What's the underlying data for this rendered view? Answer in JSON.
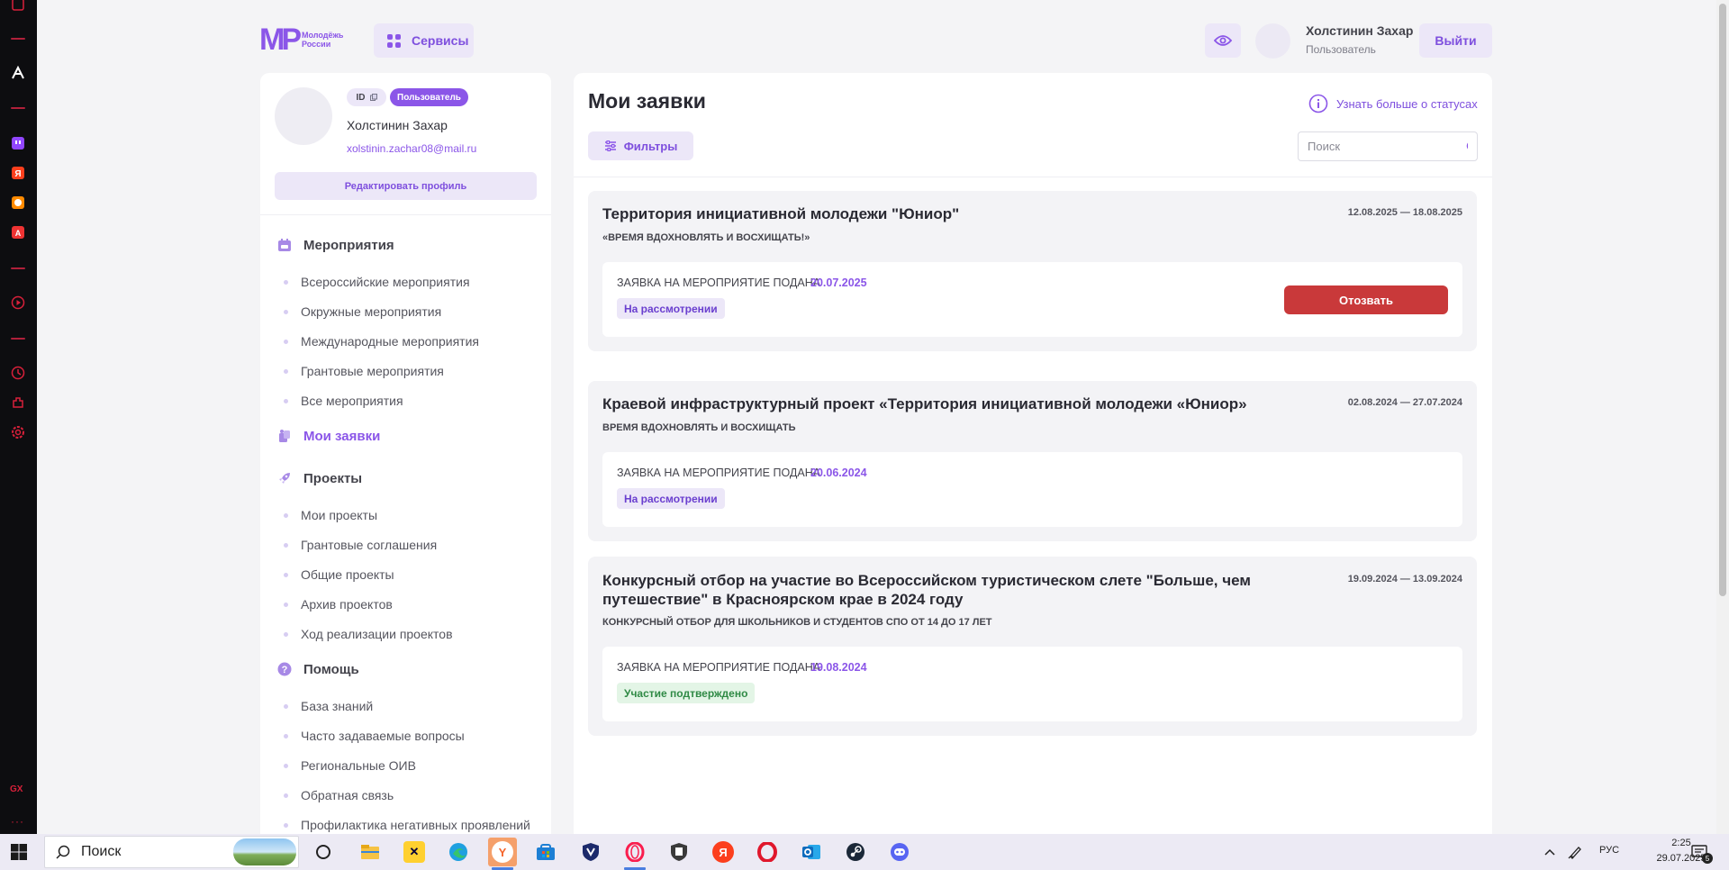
{
  "header": {
    "logo_mark": "МР",
    "logo_line1": "Молодёжь",
    "logo_line2": "России",
    "services_label": "Сервисы",
    "user_name": "Холстинин Захар",
    "user_role": "Пользователь",
    "logout_label": "Выйти"
  },
  "profile": {
    "id_label": "ID",
    "role_badge": "Пользователь",
    "name": "Холстинин Захар",
    "email": "xolstinin.zachar08@mail.ru",
    "edit_label": "Редактировать профиль"
  },
  "nav": {
    "events": {
      "title": "Мероприятия",
      "items": [
        "Всероссийские мероприятия",
        "Окружные мероприятия",
        "Международные мероприятия",
        "Грантовые мероприятия",
        "Все мероприятия"
      ]
    },
    "my_applications": "Мои заявки",
    "projects": {
      "title": "Проекты",
      "items": [
        "Мои проекты",
        "Грантовые соглашения",
        "Общие проекты",
        "Архив проектов",
        "Ход реализации проектов"
      ]
    },
    "help": {
      "title": "Помощь",
      "items": [
        "База знаний",
        "Часто задаваемые вопросы",
        "Региональные ОИВ",
        "Обратная связь",
        "Профилактика негативных проявлений"
      ]
    }
  },
  "main": {
    "title": "Мои заявки",
    "status_info": "Узнать больше о статусах",
    "filters_label": "Фильтры",
    "search_placeholder": "Поиск",
    "applications": [
      {
        "title": "Территория инициативной молодежи \"Юниор\"",
        "subtitle": "«ВРЕМЯ ВДОХНОВЛЯТЬ И ВОСХИЩАТЬ!»",
        "dates": "12.08.2025 — 18.08.2025",
        "submitted_label": "ЗАЯВКА НА МЕРОПРИЯТИЕ ПОДАНА",
        "submitted_date": "20.07.2025",
        "status": "На рассмотрении",
        "action": "Отозвать"
      },
      {
        "title": "Краевой инфраструктурный проект «Территория инициативной молодежи «Юниор»",
        "subtitle": "ВРЕМЯ ВДОХНОВЛЯТЬ И ВОСХИЩАТЬ",
        "dates": "02.08.2024 — 27.07.2024",
        "submitted_label": "ЗАЯВКА НА МЕРОПРИЯТИЕ ПОДАНА",
        "submitted_date": "20.06.2024",
        "status": "На рассмотрении"
      },
      {
        "title_line1": "Конкурсный отбор на участие во Всероссийском туристическом слете \"Больше, чем",
        "title_line2": "путешествие\" в Красноярском крае в 2024 году",
        "subtitle": "КОНКУРСНЫЙ ОТБОР ДЛЯ ШКОЛЬНИКОВ И СТУДЕНТОВ СПО ОТ 14 ДО 17 ЛЕТ",
        "dates": "19.09.2024 — 13.09.2024",
        "submitted_label": "ЗАЯВКА НА МЕРОПРИЯТИЕ ПОДАНА",
        "submitted_date": "19.08.2024",
        "status": "Участие подтверждено"
      }
    ]
  },
  "taskbar": {
    "search_label": "Поиск",
    "lang": "РУС",
    "time": "2:25",
    "date": "29.07.2025",
    "notif_count": "5"
  },
  "colors": {
    "accent": "#8b56e8",
    "accent_light": "#ece7f8",
    "danger": "#c9393a",
    "success_bg": "#e3f5e6",
    "success_text": "#2f8a45"
  }
}
